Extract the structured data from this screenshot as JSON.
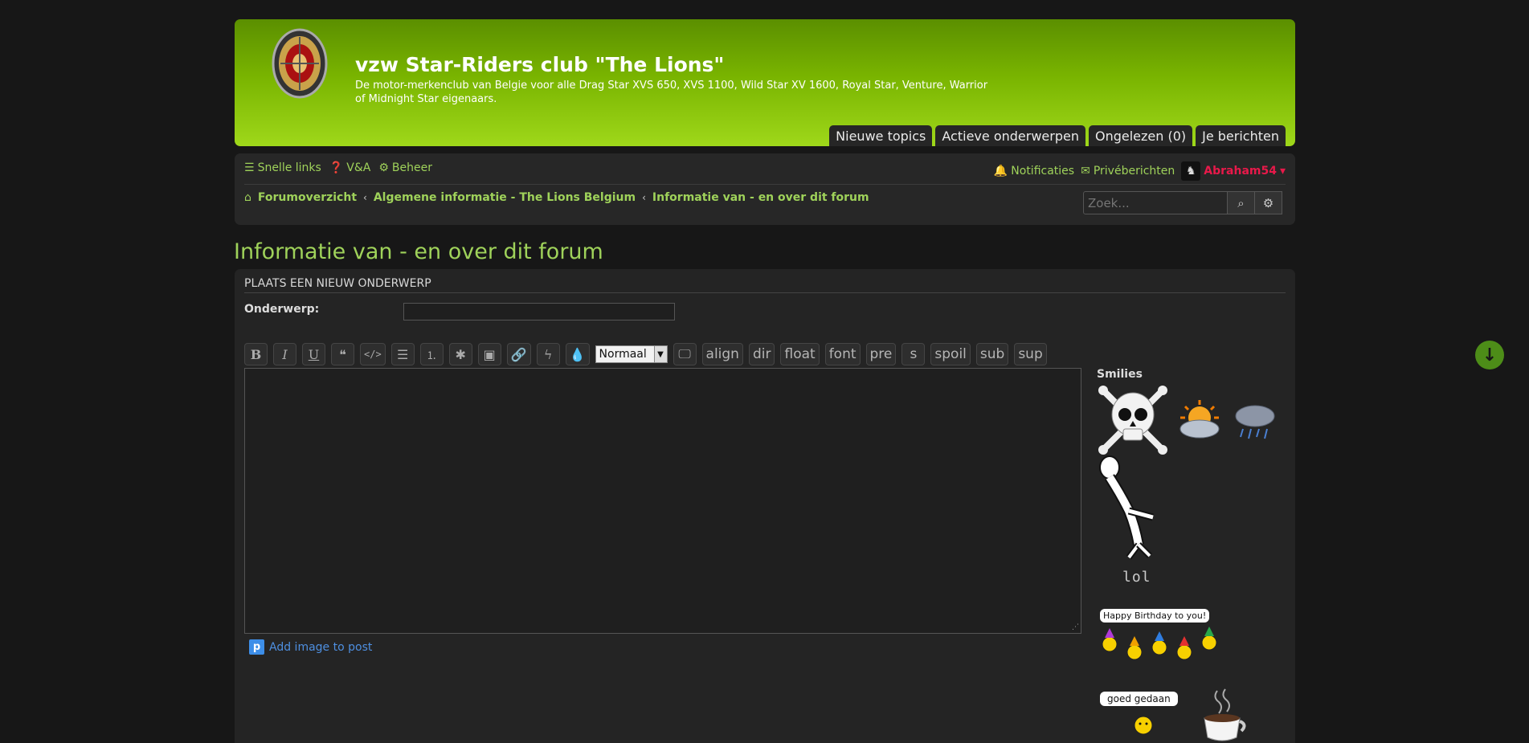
{
  "header": {
    "title": "vzw Star-Riders club \"The Lions\"",
    "description": "De motor-merkenclub van Belgie voor alle Drag Star XVS 650, XVS 1100, Wild Star XV 1600, Royal Star, Venture, Warrior of Midnight Star eigenaars.",
    "tabs": [
      "Nieuwe topics",
      "Actieve onderwerpen",
      "Ongelezen (0)",
      "Je berichten"
    ]
  },
  "nav": {
    "quick_links": "Snelle links",
    "faq": "V&A",
    "admin": "Beheer",
    "notifications": "Notificaties",
    "messages": "Privéberichten",
    "username": "Abraham54"
  },
  "breadcrumbs": {
    "home": "Forumoverzicht",
    "category": "Algemene informatie - The Lions Belgium",
    "forum": "Informatie van - en over dit forum"
  },
  "search": {
    "placeholder": "Zoek..."
  },
  "page": {
    "title": "Informatie van - en over dit forum"
  },
  "post_form": {
    "heading": "PLAATS EEN NIEUW ONDERWERP",
    "subject_label": "Onderwerp:",
    "subject_value": "",
    "font_size": "Normaal",
    "bbcodes": [
      "align",
      "dir",
      "float",
      "font",
      "pre",
      "s",
      "spoil",
      "sub",
      "sup"
    ],
    "add_image": "Add image to post"
  },
  "smilies": {
    "title": "Smilies",
    "lol_text": "lol",
    "birthday_text": "Happy Birthday to you!",
    "good_job_text": "goed gedaan"
  },
  "colors": {
    "accent": "#9fd25a",
    "username": "#e8194a",
    "header_top": "#5b8f00",
    "header_bottom": "#9fd81a"
  }
}
